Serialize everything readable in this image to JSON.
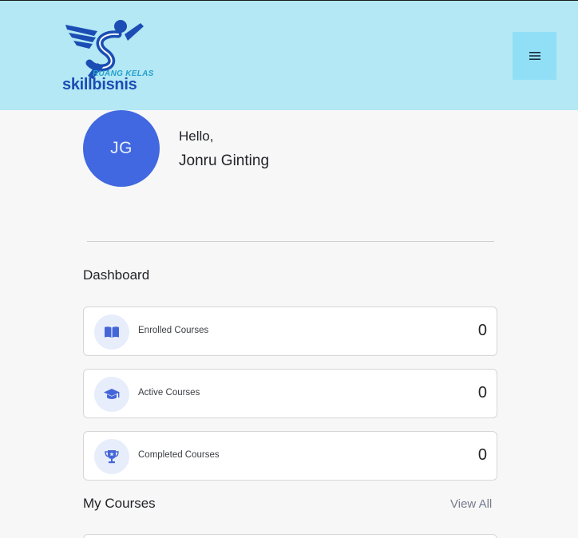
{
  "header": {
    "logo": {
      "tagline": "RUANG KELAS",
      "brand": "skillbisnis"
    },
    "menu_icon": "hamburger-menu-icon"
  },
  "profile": {
    "initials": "JG",
    "greeting": "Hello,",
    "name": "Jonru Ginting"
  },
  "dashboard": {
    "title": "Dashboard",
    "stats": [
      {
        "label": "Enrolled Courses",
        "value": "0",
        "icon": "open-book-icon"
      },
      {
        "label": "Active Courses",
        "value": "0",
        "icon": "graduation-cap-icon"
      },
      {
        "label": "Completed Courses",
        "value": "0",
        "icon": "trophy-icon"
      }
    ]
  },
  "my_courses": {
    "title": "My Courses",
    "view_all": "View All"
  },
  "colors": {
    "header_bg": "#b3e8f4",
    "menu_button_bg": "#91dff7",
    "avatar_bg": "#4168e0",
    "icon_accent": "#4566d8",
    "page_bg": "#f7f7f7"
  }
}
